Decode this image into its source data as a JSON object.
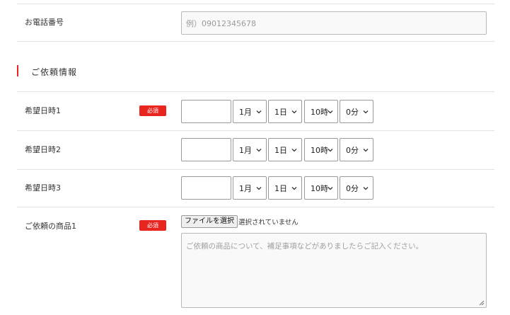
{
  "phone": {
    "label": "お電話番号",
    "placeholder": "例）09012345678"
  },
  "section": {
    "title": "ご依頼情報"
  },
  "required_badge": "必須",
  "preferred_dates": [
    {
      "label": "希望日時1",
      "required": true,
      "month": "1月",
      "day": "1日",
      "hour": "10時",
      "minute": "0分"
    },
    {
      "label": "希望日時2",
      "required": false,
      "month": "1月",
      "day": "1日",
      "hour": "10時",
      "minute": "0分"
    },
    {
      "label": "希望日時3",
      "required": false,
      "month": "1月",
      "day": "1日",
      "hour": "10時",
      "minute": "0分"
    }
  ],
  "item1": {
    "label": "ご依頼の商品1",
    "file_button": "ファイルを選択",
    "file_status": "選択されていません",
    "textarea_placeholder": "ご依頼の商品について、補足事項などがありましたらご記入ください。"
  },
  "colors": {
    "accent_red": "#e8261f",
    "divider": "#e2e2e2"
  }
}
